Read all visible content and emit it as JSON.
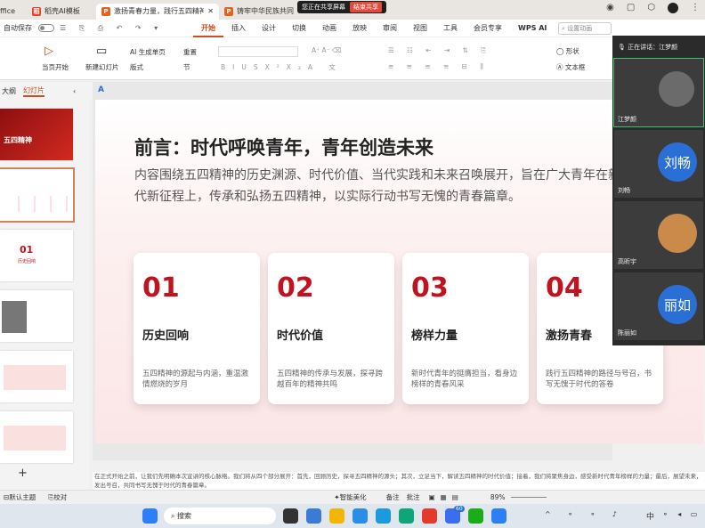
{
  "tabs": [
    {
      "label": "ffice",
      "icon": "",
      "color": "#333"
    },
    {
      "label": "稻壳AI模板",
      "icon": "稻",
      "color": "#e3442c"
    },
    {
      "label": "激扬青春力量，践行五四精神",
      "icon": "P",
      "color": "#e6601e"
    },
    {
      "label": "铸牢中华民族共同",
      "icon": "P",
      "color": "#e6601e"
    }
  ],
  "share": {
    "status": "您正在共享屏幕",
    "end": "结束共享"
  },
  "menu": {
    "autosave": "自动保存",
    "items": [
      "开始",
      "插入",
      "设计",
      "切换",
      "动画",
      "放映",
      "审阅",
      "视图",
      "工具",
      "会员专享",
      "WPS AI"
    ],
    "search": "设置动画"
  },
  "toolbar": {
    "play": "当页开始",
    "newslide": "新建幻灯片",
    "ai": "AI 生成单页",
    "reset": "重置",
    "layout": "版式",
    "section": "节",
    "shape": "形状",
    "textbox": "文本框"
  },
  "panel": {
    "tabs": [
      "大纲",
      "幻灯片"
    ],
    "add": "+"
  },
  "thumbs": {
    "t2": "01",
    "t2sub": "历史回响",
    "t1": "五四精神"
  },
  "slide": {
    "title": "前言：时代呼唤青年，青年创造未来",
    "body": "内容围绕五四精神的历史渊源、时代价值、当代实践和未来召唤展开，旨在广大青年在新时代新征程上，传承和弘扬五四精神，以实际行动书写无愧的青春篇章。",
    "cards": [
      {
        "num": "01",
        "title": "历史回响",
        "desc": "五四精神的源起与内涵，重温激情燃烧的岁月"
      },
      {
        "num": "02",
        "title": "时代价值",
        "desc": "五四精神的传承与发展，探寻跨越百年的精神共鸣"
      },
      {
        "num": "03",
        "title": "榜样力量",
        "desc": "新时代青年的挺膺担当，看身边榜样的青春风采"
      },
      {
        "num": "04",
        "title": "激扬青春",
        "desc": "践行五四精神的路径与号召，书写无愧于时代的答卷"
      }
    ]
  },
  "meeting": {
    "speaking": "正在讲话：江梦颜",
    "participants": [
      {
        "name": "江梦颜",
        "avatar": "",
        "color": "#555"
      },
      {
        "name": "刘畅",
        "avatar": "刘畅",
        "color": "#2a6fd6"
      },
      {
        "name": "高昕宇",
        "avatar": "",
        "color": "#c98a4a"
      },
      {
        "name": "陈丽如",
        "avatar": "丽如",
        "color": "#2a6fd6"
      }
    ]
  },
  "notes": "在正式开始之前，让我们先明确本次宣讲的核心脉络。我们将从四个部分展开：首先，回顾历史，探寻五四精神的源头；其次，立足当下，解读五四精神的时代价值；接着，我们将聚焦身边，感受新时代青年榜样的力量；最后，展望未来，发出号召，共同书写无愧于时代的青春篇章。",
  "status": {
    "theme": "默认主题",
    "proof": "校对",
    "beautify": "智能美化",
    "notes": "备注",
    "comment": "批注",
    "zoom": "89%"
  },
  "taskbar": {
    "search": "搜索",
    "ime": "中",
    "badge": "60"
  }
}
